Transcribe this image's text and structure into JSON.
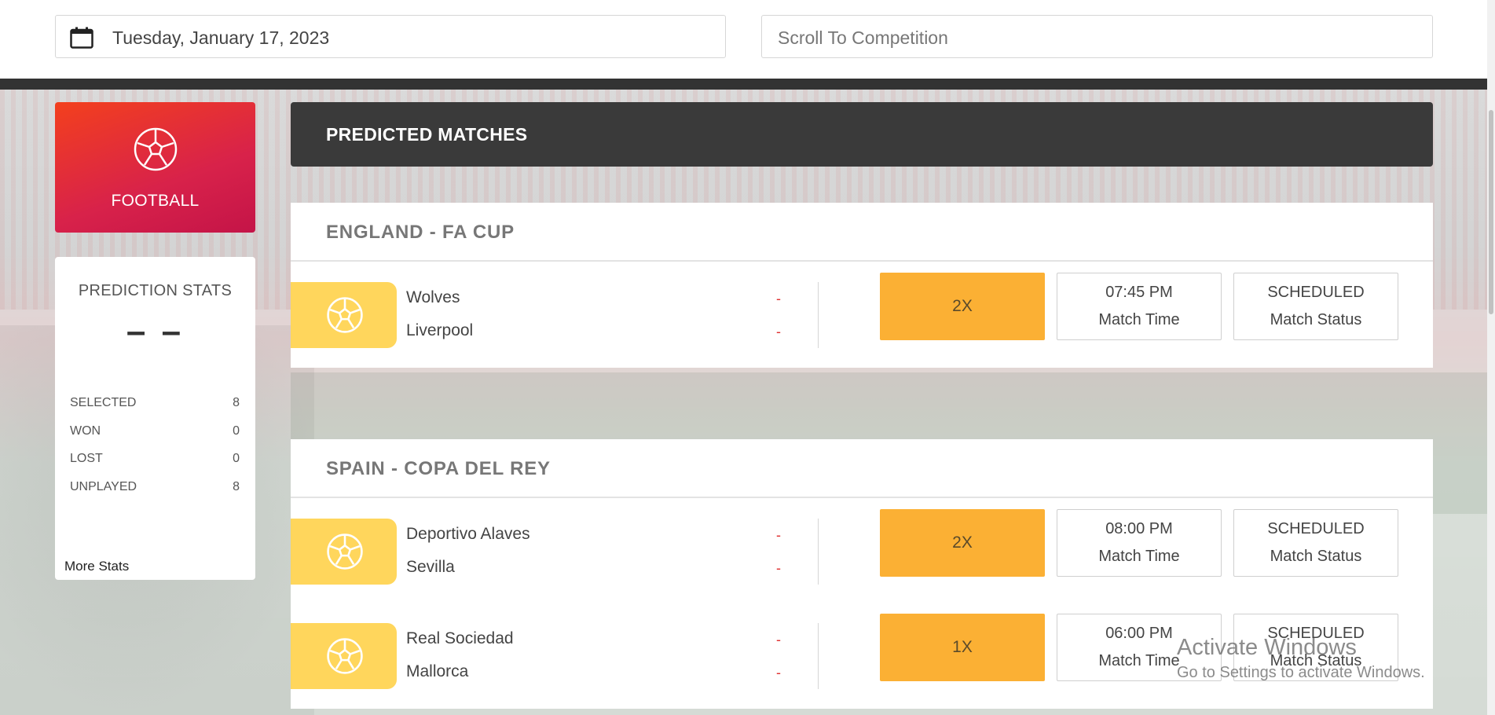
{
  "topbar": {
    "date_value": "Tuesday, January 17, 2023",
    "scroll_placeholder": "Scroll To Competition"
  },
  "sidebar": {
    "sport_name": "FOOTBALL",
    "stats_title": "PREDICTION STATS",
    "stats_big_value": "– –",
    "stats": [
      {
        "label": "SELECTED",
        "value": "8"
      },
      {
        "label": "WON",
        "value": "0"
      },
      {
        "label": "LOST",
        "value": "0"
      },
      {
        "label": "UNPLAYED",
        "value": "8"
      }
    ],
    "more_stats": "More Stats"
  },
  "main": {
    "header": "PREDICTED MATCHES",
    "competitions": [
      {
        "title": "ENGLAND - FA CUP",
        "matches": [
          {
            "home": "Wolves",
            "away": "Liverpool",
            "home_score": "-",
            "away_score": "-",
            "pick": "2X",
            "time": "07:45 PM",
            "time_label": "Match Time",
            "status": "SCHEDULED",
            "status_label": "Match Status"
          }
        ]
      },
      {
        "title": "SPAIN - COPA DEL REY",
        "matches": [
          {
            "home": "Deportivo Alaves",
            "away": "Sevilla",
            "home_score": "-",
            "away_score": "-",
            "pick": "2X",
            "time": "08:00 PM",
            "time_label": "Match Time",
            "status": "SCHEDULED",
            "status_label": "Match Status"
          },
          {
            "home": "Real Sociedad",
            "away": "Mallorca",
            "home_score": "-",
            "away_score": "-",
            "pick": "1X",
            "time": "06:00 PM",
            "time_label": "Match Time",
            "status": "SCHEDULED",
            "status_label": "Match Status"
          }
        ]
      }
    ]
  },
  "watermark": {
    "line1": "Activate Windows",
    "line2": "Go to Settings to activate Windows."
  },
  "colors": {
    "accent_red": "#d8224a",
    "pick_orange": "#fbb034",
    "tab_yellow": "#ffd65c",
    "dark_header": "#3a3a3a"
  },
  "icons": [
    "calendar-icon",
    "football-icon"
  ]
}
